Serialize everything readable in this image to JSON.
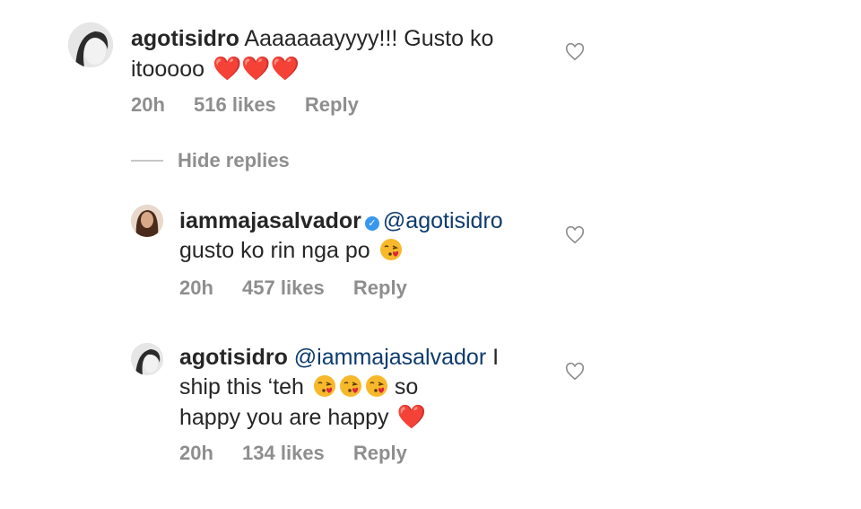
{
  "comments": [
    {
      "username": "agotisidro",
      "text": "Aaaaaaayyyy!!! Gusto ko itooooo",
      "emojis": "heart heart heart",
      "time": "20h",
      "likes": "516 likes",
      "reply": "Reply"
    }
  ],
  "hide_replies": "Hide replies",
  "replies": [
    {
      "username": "iammajasalvador",
      "verified": true,
      "mention": "@agotisidro",
      "text": "gusto ko rin nga po",
      "time": "20h",
      "likes": "457 likes",
      "reply": "Reply"
    },
    {
      "username": "agotisidro",
      "mention": "@iammajasalvador",
      "text_1": "I",
      "text_2": "ship this ‘teh",
      "text_3": "so",
      "text_4": "happy you are happy",
      "time": "20h",
      "likes": "134 likes",
      "reply": "Reply"
    }
  ],
  "icons": {
    "like": "heart-outline-icon",
    "verified": "verified-badge-icon",
    "heart_emoji": "red-heart-emoji",
    "kiss_emoji": "face-blowing-kiss-emoji"
  },
  "colors": {
    "text": "#262626",
    "meta": "#8e8e8e",
    "mention": "#0d3b6e",
    "verified": "#3897f0",
    "heart": "#e0213f"
  }
}
